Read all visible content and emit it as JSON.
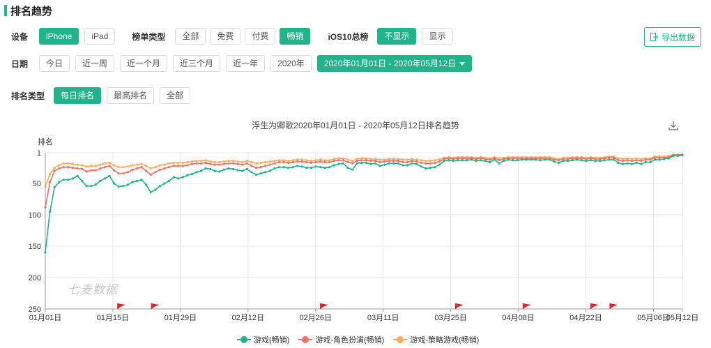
{
  "page": {
    "title": "排名趋势"
  },
  "filters": {
    "device": {
      "label": "设备",
      "options": [
        "iPhone",
        "iPad"
      ],
      "selected": "iPhone"
    },
    "list_type": {
      "label": "榜单类型",
      "options": [
        "全部",
        "免费",
        "付费",
        "畅销"
      ],
      "selected": "畅销"
    },
    "ios10": {
      "label": "iOS10总榜",
      "options": [
        "不显示",
        "显示"
      ],
      "selected": "不显示"
    },
    "date": {
      "label": "日期",
      "options": [
        "今日",
        "近一周",
        "近一个月",
        "近三个月",
        "近一年",
        "2020年"
      ],
      "range": "2020年01月01日 - 2020年05月12日"
    },
    "rank_type": {
      "label": "排名类型",
      "options": [
        "每日排名",
        "最高排名",
        "全部"
      ],
      "selected": "每日排名"
    }
  },
  "export": {
    "label": "导出数据"
  },
  "watermark": "七麦数据",
  "colors": {
    "accent": "#1fb489",
    "series": [
      "#1fb489",
      "#f07068",
      "#f9ad5c"
    ],
    "flag": "#e8212a"
  },
  "chart_data": {
    "type": "line",
    "title": "浮生为卿歌2020年01月01日 - 2020年05月12日排名趋势",
    "ylabel": "排名",
    "y_inverted": true,
    "yticks": [
      1,
      50,
      100,
      150,
      200,
      250
    ],
    "ylim": [
      1,
      250
    ],
    "x_start": "2020-01-01",
    "x_end": "2020-05-12",
    "xticks": [
      "01月01日",
      "01月15日",
      "01月29日",
      "02月12日",
      "02月26日",
      "03月11日",
      "03月25日",
      "04月08日",
      "04月22日",
      "05月06日",
      "05月12日"
    ],
    "flags": [
      "2020-01-16",
      "2020-01-23",
      "2020-02-27",
      "2020-03-26",
      "2020-04-09",
      "2020-04-23",
      "2020-04-27"
    ],
    "grid": true,
    "legend_position": "bottom",
    "series": [
      {
        "name": "游戏(畅销)",
        "values": [
          160,
          95,
          56,
          48,
          44,
          44,
          42,
          38,
          46,
          54,
          54,
          52,
          46,
          42,
          38,
          50,
          55,
          54,
          52,
          48,
          46,
          44,
          52,
          64,
          60,
          54,
          50,
          46,
          40,
          42,
          40,
          37,
          35,
          32,
          30,
          26,
          27,
          30,
          31,
          28,
          26,
          27,
          29,
          30,
          27,
          32,
          36,
          34,
          32,
          30,
          26,
          24,
          24,
          25,
          24,
          22,
          23,
          25,
          25,
          23,
          24,
          25,
          24,
          21,
          19,
          18,
          25,
          28,
          18,
          17,
          17,
          19,
          18,
          22,
          20,
          18,
          18,
          18,
          21,
          21,
          18,
          19,
          23,
          26,
          25,
          24,
          20,
          14,
          13,
          14,
          13,
          13,
          13,
          12,
          14,
          13,
          14,
          16,
          12,
          18,
          14,
          12,
          13,
          13,
          12,
          12,
          12,
          12,
          13,
          12,
          12,
          15,
          17,
          14,
          14,
          13,
          12,
          13,
          14,
          13,
          14,
          14,
          13,
          12,
          12,
          17,
          19,
          18,
          19,
          17,
          19,
          16,
          16,
          12,
          12,
          11,
          10,
          6,
          6,
          5
        ]
      },
      {
        "name": "游戏-角色扮演(畅销)",
        "values": [
          88,
          48,
          30,
          26,
          24,
          24,
          25,
          26,
          27,
          31,
          29,
          29,
          26,
          24,
          22,
          29,
          34,
          34,
          32,
          28,
          26,
          24,
          30,
          36,
          32,
          28,
          26,
          24,
          22,
          22,
          22,
          21,
          19,
          18,
          18,
          17,
          19,
          20,
          20,
          19,
          18,
          18,
          19,
          20,
          18,
          22,
          25,
          24,
          22,
          20,
          18,
          16,
          16,
          17,
          16,
          15,
          15,
          16,
          17,
          16,
          15,
          16,
          16,
          14,
          13,
          13,
          16,
          18,
          14,
          13,
          13,
          14,
          14,
          16,
          15,
          14,
          14,
          14,
          16,
          16,
          14,
          15,
          17,
          18,
          18,
          17,
          15,
          11,
          10,
          11,
          10,
          10,
          10,
          10,
          11,
          10,
          11,
          12,
          10,
          13,
          11,
          10,
          10,
          10,
          10,
          10,
          10,
          10,
          10,
          10,
          10,
          12,
          13,
          11,
          11,
          10,
          10,
          10,
          11,
          10,
          11,
          11,
          10,
          9,
          9,
          13,
          14,
          13,
          14,
          13,
          14,
          12,
          12,
          9,
          9,
          9,
          8,
          5,
          5,
          4
        ]
      },
      {
        "name": "游戏-策略游戏(畅销)",
        "values": [
          55,
          35,
          25,
          21,
          18,
          18,
          19,
          20,
          21,
          23,
          22,
          22,
          20,
          18,
          17,
          21,
          24,
          24,
          23,
          21,
          20,
          19,
          22,
          26,
          24,
          21,
          20,
          18,
          17,
          17,
          17,
          16,
          15,
          14,
          14,
          13,
          15,
          16,
          16,
          15,
          14,
          14,
          15,
          16,
          14,
          16,
          18,
          17,
          16,
          15,
          14,
          13,
          13,
          14,
          13,
          12,
          12,
          13,
          14,
          13,
          12,
          13,
          13,
          11,
          10,
          10,
          12,
          14,
          11,
          10,
          10,
          11,
          11,
          12,
          12,
          11,
          11,
          11,
          12,
          12,
          11,
          12,
          13,
          14,
          14,
          13,
          12,
          9,
          8,
          9,
          8,
          8,
          8,
          8,
          9,
          8,
          9,
          10,
          8,
          10,
          9,
          8,
          8,
          8,
          8,
          8,
          8,
          8,
          8,
          8,
          8,
          10,
          11,
          9,
          9,
          8,
          8,
          8,
          9,
          8,
          9,
          9,
          8,
          7,
          7,
          10,
          11,
          10,
          11,
          10,
          11,
          10,
          10,
          7,
          7,
          7,
          6,
          4,
          4,
          4
        ]
      }
    ]
  }
}
